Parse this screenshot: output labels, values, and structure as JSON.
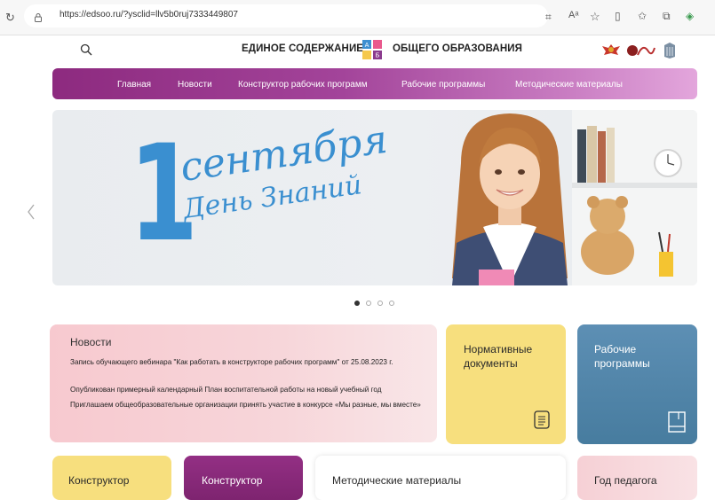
{
  "browser": {
    "url": "https://edsoo.ru/?ysclid=llv5b0ruj7333449807"
  },
  "header": {
    "title_left": "ЕДИНОЕ СОДЕРЖАНИЕ",
    "title_right": "ОБЩЕГО ОБРАЗОВАНИЯ"
  },
  "nav": {
    "items": [
      {
        "label": "Главная"
      },
      {
        "label": "Новости"
      },
      {
        "label": "Конструктор рабочих программ"
      },
      {
        "label": "Рабочие программы"
      },
      {
        "label": "Методические материалы"
      }
    ]
  },
  "banner": {
    "number": "1",
    "line1": "сентября",
    "line2": "День Знаний",
    "slides_total": 4,
    "active_slide": 1
  },
  "news": {
    "title": "Новости",
    "items": [
      {
        "text": "Запись обучающего вебинара \"Как работать в конструкторе рабочих программ\" от 25.08.2023 г."
      },
      {
        "text": "Опубликован примерный календарный План воспитательной работы на новый учебный год"
      },
      {
        "text": "Приглашаем общеобразовательные организации принять участие в конкурсе «Мы разные, мы вместе»"
      }
    ]
  },
  "cards": {
    "normative": "Нормативные документы",
    "work_programs": "Рабочие программы",
    "constructor_1": "Конструктор",
    "constructor_2": "Конструктор",
    "methodical": "Методические материалы",
    "teacher_year": "Год педагога"
  },
  "colors": {
    "nav_start": "#8d2a7f",
    "nav_end": "#e3a6dc",
    "banner_blue": "#3a8fd0",
    "card_yellow": "#f7df7e",
    "card_blue": "#4f86ab",
    "card_purple": "#8b2b7d"
  }
}
